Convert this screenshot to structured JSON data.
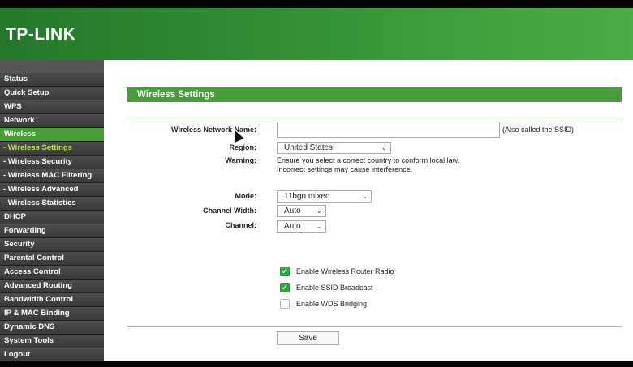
{
  "header": {
    "logo": "TP-LINK"
  },
  "sidebar": {
    "items": [
      {
        "label": "Status",
        "type": "main"
      },
      {
        "label": "Quick Setup",
        "type": "main"
      },
      {
        "label": "WPS",
        "type": "main"
      },
      {
        "label": "Network",
        "type": "main"
      },
      {
        "label": "Wireless",
        "type": "main",
        "active": true
      },
      {
        "label": "- Wireless Settings",
        "type": "sub",
        "current": true
      },
      {
        "label": "- Wireless Security",
        "type": "sub"
      },
      {
        "label": "- Wireless MAC Filtering",
        "type": "sub"
      },
      {
        "label": "- Wireless Advanced",
        "type": "sub"
      },
      {
        "label": "- Wireless Statistics",
        "type": "sub"
      },
      {
        "label": "DHCP",
        "type": "main"
      },
      {
        "label": "Forwarding",
        "type": "main"
      },
      {
        "label": "Security",
        "type": "main"
      },
      {
        "label": "Parental Control",
        "type": "main"
      },
      {
        "label": "Access Control",
        "type": "main"
      },
      {
        "label": "Advanced Routing",
        "type": "main"
      },
      {
        "label": "Bandwidth Control",
        "type": "main"
      },
      {
        "label": "IP & MAC Binding",
        "type": "main"
      },
      {
        "label": "Dynamic DNS",
        "type": "main"
      },
      {
        "label": "System Tools",
        "type": "main"
      },
      {
        "label": "Logout",
        "type": "main"
      }
    ]
  },
  "main": {
    "section_title": "Wireless Settings",
    "ssid_label": "Wireless Network Name:",
    "ssid_value": "",
    "ssid_note": "(Also called the SSID)",
    "region_label": "Region:",
    "region_value": "United States",
    "warning_label": "Warning:",
    "warning_line1": "Ensure you select a correct country to conform local law.",
    "warning_line2": "Incorrect settings may cause interference.",
    "mode_label": "Mode:",
    "mode_value": "11bgn mixed",
    "channel_width_label": "Channel Width:",
    "channel_width_value": "Auto",
    "channel_label": "Channel:",
    "channel_value": "Auto",
    "options": [
      {
        "label": "Enable Wireless Router Radio",
        "checked": true
      },
      {
        "label": "Enable SSID Broadcast",
        "checked": true
      },
      {
        "label": "Enable WDS Bridging",
        "checked": false
      }
    ],
    "save_label": "Save"
  },
  "colors": {
    "header_green": "#2f8a33",
    "accent_green": "#4a9d3c",
    "sidebar_dark": "#3a3a3a",
    "submenu_highlight": "#b9e25a"
  },
  "icons": {
    "dropdown": "chevron-down-icon",
    "checkbox": "check-icon"
  }
}
